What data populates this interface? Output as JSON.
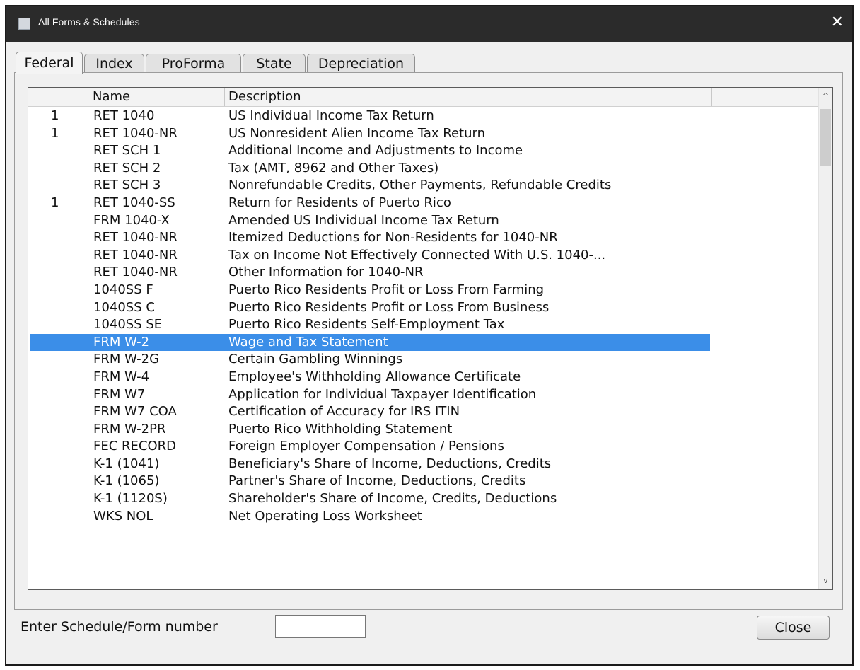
{
  "window": {
    "title": "All Forms & Schedules",
    "close_glyph": "✕"
  },
  "tabs": [
    {
      "label": "Federal",
      "active": true
    },
    {
      "label": "Index"
    },
    {
      "label": "ProForma"
    },
    {
      "label": "State"
    },
    {
      "label": "Depreciation"
    }
  ],
  "list": {
    "columns": {
      "count": "",
      "name": "Name",
      "description": "Description"
    },
    "rows": [
      {
        "count": "1",
        "name": "RET 1040",
        "description": "US Individual Income Tax Return"
      },
      {
        "count": "1",
        "name": "RET 1040-NR",
        "description": "US Nonresident Alien Income Tax Return"
      },
      {
        "count": "",
        "name": "RET SCH 1",
        "description": "Additional Income and Adjustments to Income"
      },
      {
        "count": "",
        "name": "RET SCH 2",
        "description": "Tax (AMT, 8962 and Other Taxes)"
      },
      {
        "count": "",
        "name": "RET SCH 3",
        "description": "Nonrefundable Credits, Other Payments, Refundable Credits"
      },
      {
        "count": "1",
        "name": "RET 1040-SS",
        "description": "Return for Residents of Puerto Rico"
      },
      {
        "count": "",
        "name": "FRM 1040-X",
        "description": "Amended US Individual Income Tax Return"
      },
      {
        "count": "",
        "name": "RET 1040-NR",
        "description": "Itemized Deductions for Non-Residents for 1040-NR"
      },
      {
        "count": "",
        "name": "RET 1040-NR",
        "description": "Tax on Income Not Effectively Connected With U.S. 1040-..."
      },
      {
        "count": "",
        "name": "RET 1040-NR",
        "description": "Other Information for 1040-NR"
      },
      {
        "count": "",
        "name": "1040SS F",
        "description": "Puerto Rico Residents Profit or Loss From Farming"
      },
      {
        "count": "",
        "name": "1040SS C",
        "description": "Puerto Rico Residents Profit or Loss From Business"
      },
      {
        "count": "",
        "name": "1040SS SE",
        "description": "Puerto Rico Residents Self-Employment Tax"
      },
      {
        "count": "",
        "name": "FRM W-2",
        "description": "Wage and Tax Statement",
        "selected": true
      },
      {
        "count": "",
        "name": "FRM W-2G",
        "description": "Certain Gambling Winnings"
      },
      {
        "count": "",
        "name": "FRM W-4",
        "description": "Employee's Withholding Allowance Certificate"
      },
      {
        "count": "",
        "name": "FRM W7",
        "description": "Application for Individual Taxpayer Identification"
      },
      {
        "count": "",
        "name": "FRM W7 COA",
        "description": "Certification of Accuracy for IRS ITIN"
      },
      {
        "count": "",
        "name": "FRM W-2PR",
        "description": "Puerto Rico Withholding Statement"
      },
      {
        "count": "",
        "name": "FEC RECORD",
        "description": "Foreign Employer Compensation / Pensions"
      },
      {
        "count": "",
        "name": "K-1 (1041)",
        "description": "Beneficiary's Share of Income, Deductions, Credits"
      },
      {
        "count": "",
        "name": "K-1 (1065)",
        "description": "Partner's Share of Income, Deductions, Credits"
      },
      {
        "count": "",
        "name": "K-1 (1120S)",
        "description": "Shareholder's Share of Income, Credits, Deductions"
      },
      {
        "count": "",
        "name": "WKS NOL",
        "description": "Net Operating Loss Worksheet"
      }
    ]
  },
  "scrollbar": {
    "up_glyph": "^",
    "down_glyph": "v"
  },
  "footer": {
    "entry_label": "Enter Schedule/Form number",
    "entry_value": "",
    "close_label": "Close"
  },
  "colors": {
    "selection": "#3b8ee8",
    "titlebar": "#2b2b2b"
  }
}
